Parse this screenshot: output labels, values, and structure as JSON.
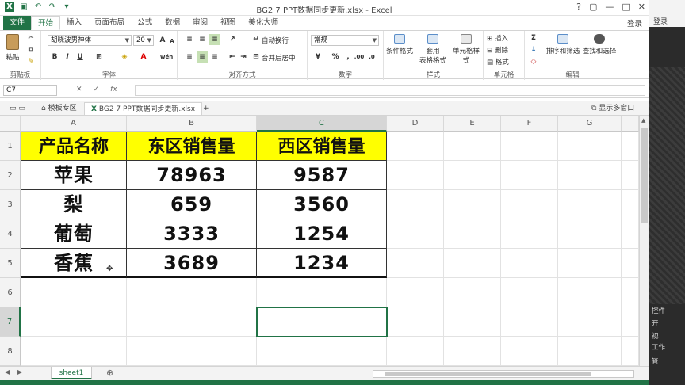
{
  "titlebar": {
    "title": "BG2 7 PPT数据同步更新.xlsx - Excel",
    "help": "?",
    "restore": "▢",
    "minimize": "—",
    "maximize": "□",
    "close": "✕"
  },
  "tabs": [
    "文件",
    "开始",
    "插入",
    "页面布局",
    "公式",
    "数据",
    "审阅",
    "视图",
    "美化大师"
  ],
  "login": "登录",
  "ribbon": {
    "paste": "粘贴",
    "clipboard_label": "剪贴板",
    "font_name": "胡晓波男神体",
    "font_size": "20",
    "font_label": "字体",
    "wrap": "自动换行",
    "merge": "合并后居中",
    "align_label": "对齐方式",
    "number_format": "常规",
    "percent": "%",
    "comma": ",",
    "number_label": "数字",
    "cond_format": "条件格式",
    "table_format_1": "套用",
    "table_format_2": "表格格式",
    "cell_style": "单元格样式",
    "styles_label": "样式",
    "insert": "插入",
    "delete": "删除",
    "format": "格式",
    "cells_label": "单元格",
    "sort": "排序和筛选",
    "find": "查找和选择",
    "edit_label": "编辑"
  },
  "formula": {
    "name_box": "C7",
    "fx": "fx"
  },
  "doctabs": {
    "tab1": "模板专区",
    "tab2": "BG2 7 PPT数据同步更新.xlsx",
    "add": "+",
    "multi": "显示多窗口"
  },
  "grid": {
    "columns": [
      "A",
      "B",
      "C",
      "D",
      "E",
      "F",
      "G"
    ],
    "rows": [
      "1",
      "2",
      "3",
      "4",
      "5",
      "6",
      "7",
      "8"
    ],
    "headers": [
      "产品名称",
      "东区销售量",
      "西区销售量"
    ],
    "data": [
      [
        "苹果",
        "78963",
        "9587"
      ],
      [
        "梨",
        "659",
        "3560"
      ],
      [
        "葡萄",
        "3333",
        "1254"
      ],
      [
        "香蕉",
        "3689",
        "1234"
      ]
    ],
    "header_fill": "#ffff00"
  },
  "sheets": {
    "active": "sheet1",
    "add": "⊕"
  },
  "right_panel": {
    "login": "登录",
    "items": [
      "控件",
      "开",
      "视",
      "工作",
      "管"
    ]
  },
  "colors": {
    "accent": "#217346"
  }
}
